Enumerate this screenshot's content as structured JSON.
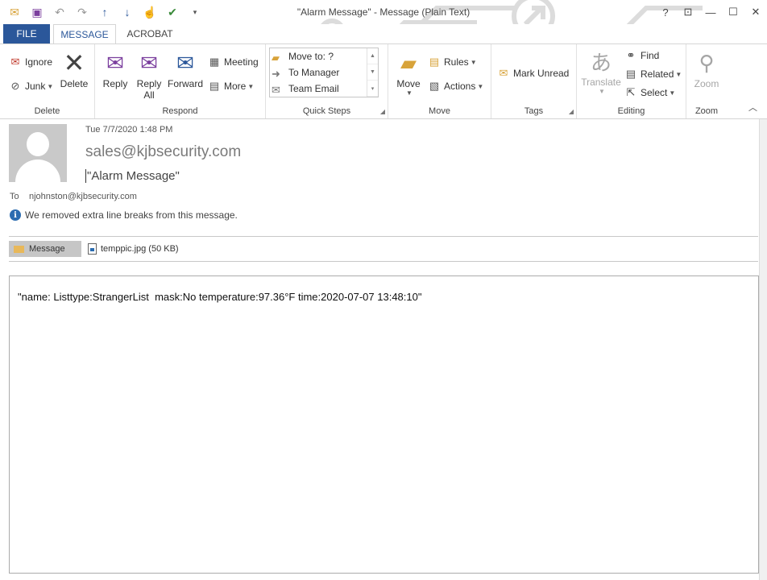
{
  "window": {
    "title": "\"Alarm Message\" - Message (Plain Text)",
    "help": "?",
    "restore_ribbon": "⊡",
    "minimize": "—",
    "maximize": "☐",
    "close": "✕"
  },
  "qat": {
    "icons": [
      "envelope-icon",
      "save-icon",
      "undo-icon",
      "redo-icon",
      "up-arrow-icon",
      "down-arrow-icon",
      "touch-mode-icon",
      "mark-icon",
      "customize-icon"
    ]
  },
  "tabs": {
    "file": "FILE",
    "message": "MESSAGE",
    "acrobat": "ACROBAT"
  },
  "ribbon": {
    "delete_group": {
      "label": "Delete",
      "ignore": "Ignore",
      "junk": "Junk",
      "delete": "Delete"
    },
    "respond_group": {
      "label": "Respond",
      "reply": "Reply",
      "reply_all_line1": "Reply",
      "reply_all_line2": "All",
      "forward": "Forward",
      "meeting": "Meeting",
      "more": "More"
    },
    "quick_steps_group": {
      "label": "Quick Steps",
      "items": [
        "Move to: ?",
        "To Manager",
        "Team Email"
      ]
    },
    "move_group": {
      "label": "Move",
      "move": "Move",
      "rules": "Rules",
      "actions": "Actions"
    },
    "tags_group": {
      "label": "Tags",
      "mark_unread": "Mark Unread"
    },
    "editing_group": {
      "label": "Editing",
      "translate": "Translate",
      "find": "Find",
      "related": "Related",
      "select": "Select"
    },
    "zoom_group": {
      "label": "Zoom",
      "zoom": "Zoom"
    }
  },
  "message": {
    "date": "Tue 7/7/2020 1:48 PM",
    "sender": "sales@kjbsecurity.com",
    "subject": "\"Alarm Message\"",
    "to_label": "To",
    "to_value": "njohnston@kjbsecurity.com",
    "info": "We removed extra line breaks from this message.",
    "attachments": {
      "message_tab": "Message",
      "file": "temppic.jpg (50 KB)"
    },
    "body": "\"name: Listtype:StrangerList  mask:No temperature:97.36°F time:2020-07-07 13:48:10\""
  },
  "colors": {
    "accent": "#2b579a",
    "info": "#2b6cb0"
  }
}
